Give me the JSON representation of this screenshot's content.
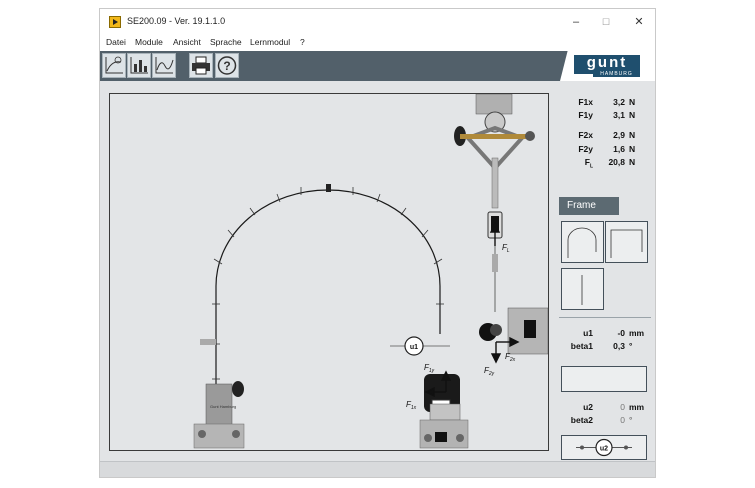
{
  "window": {
    "title": "SE200.09 - Ver. 19.1.1.0",
    "controls": {
      "minimize": "–",
      "maximize": "☐",
      "close": "✕"
    }
  },
  "menu": {
    "items": [
      "Datei",
      "Module",
      "Ansicht",
      "Sprache",
      "Lernmodul",
      "?"
    ]
  },
  "toolbar": {
    "icons": [
      "chart-arrow-icon",
      "chart-bars-icon",
      "chart-curve-icon",
      "printer-icon",
      "help-icon"
    ],
    "help_glyph": "?",
    "logo_text": "gunt",
    "logo_sub": "HAMBURG"
  },
  "forces": [
    {
      "label": "F1x",
      "value": "3,2",
      "unit": "N"
    },
    {
      "label": "F1y",
      "value": "3,1",
      "unit": "N"
    },
    {
      "label": "F2x",
      "value": "2,9",
      "unit": "N"
    },
    {
      "label": "F2y",
      "value": "1,6",
      "unit": "N"
    },
    {
      "label": "FL",
      "main": "F",
      "sub": "L",
      "value": "20,8",
      "unit": "N"
    }
  ],
  "frame_panel": {
    "title": "Frame"
  },
  "measure1": [
    {
      "label": "u1",
      "value": "-0",
      "unit": "mm"
    },
    {
      "label": "beta1",
      "value": "0,3",
      "unit": "°"
    }
  ],
  "measure2": [
    {
      "label": "u2",
      "value": "0",
      "unit": "mm"
    },
    {
      "label": "beta2",
      "value": "0",
      "unit": "°"
    }
  ],
  "diagram": {
    "u1_label": "u1",
    "u2_label": "u2",
    "force_labels": {
      "FL": {
        "main": "F",
        "sub": "L"
      },
      "F1y": {
        "main": "F",
        "sub": "1y"
      },
      "F1x": {
        "main": "F",
        "sub": "1x"
      },
      "F2x": {
        "main": "F",
        "sub": "2x"
      },
      "F2y": {
        "main": "F",
        "sub": "2y"
      }
    },
    "stand_text": "Gunt Hamburg"
  },
  "colors": {
    "toolbar": "#52606a",
    "panel_header": "#5c6a72",
    "workspace": "#e3e5e7",
    "logo": "#1f4f6e"
  }
}
